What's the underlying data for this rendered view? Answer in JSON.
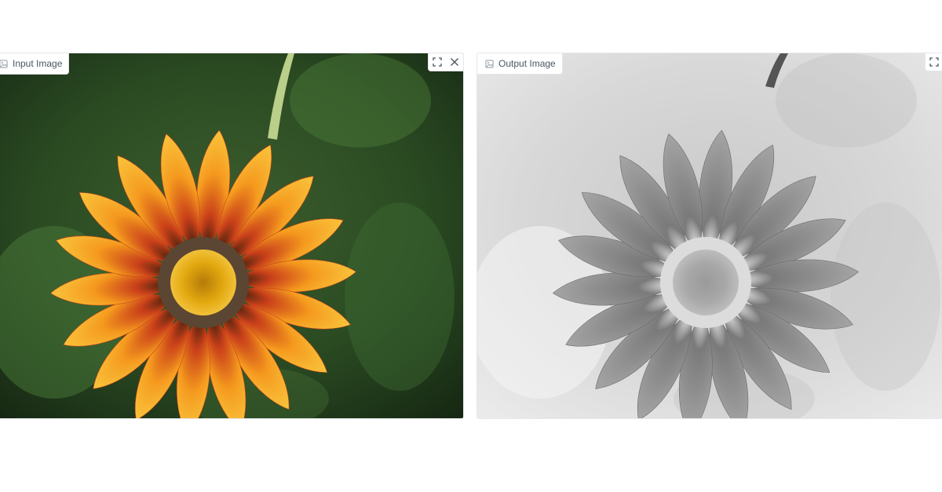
{
  "input_panel": {
    "label": "Input Image",
    "image_icon": "image-icon",
    "toolbar": [
      {
        "icon": "fullscreen-icon",
        "title": "Fullscreen"
      },
      {
        "icon": "close-icon",
        "title": "Clear"
      }
    ],
    "image": {
      "subject": "orange gazania flower",
      "colors": {
        "background": "#1f3a1c",
        "petal": "#f7b12a",
        "stripe": "#c9401a",
        "center": "#e3a50e",
        "ring": "#5a4632"
      }
    }
  },
  "output_panel": {
    "label": "Output Image",
    "image_icon": "image-icon",
    "toolbar": [
      {
        "icon": "fullscreen-icon",
        "title": "Fullscreen"
      }
    ],
    "image": {
      "subject": "inverted grayscale flower",
      "colors": {
        "background": "#e2e2e2",
        "petal": "#8a8a8a",
        "stripe": "#6a6a6a",
        "center": "#9a9a9a",
        "ring": "#d8d8d8"
      }
    }
  }
}
